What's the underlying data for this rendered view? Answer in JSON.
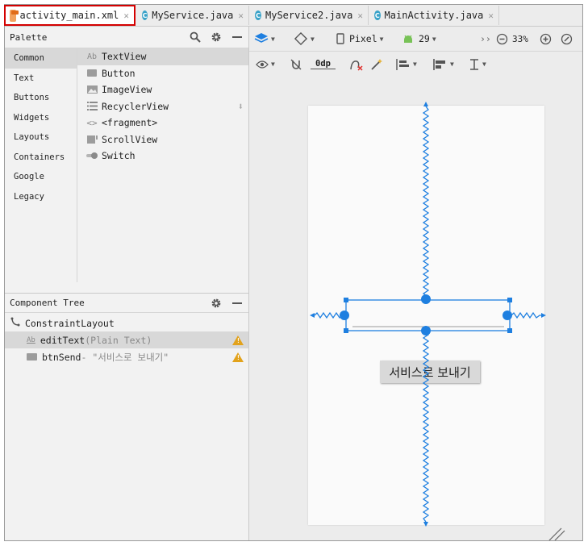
{
  "tabs": [
    {
      "label": "activity_main.xml",
      "icon": "xml-file-icon",
      "active": true
    },
    {
      "label": "MyService.java",
      "icon": "java-class-icon",
      "active": false
    },
    {
      "label": "MyService2.java",
      "icon": "java-class-icon",
      "active": false
    },
    {
      "label": "MainActivity.java",
      "icon": "java-class-icon",
      "active": false
    }
  ],
  "palette": {
    "title": "Palette",
    "categories": [
      "Common",
      "Text",
      "Buttons",
      "Widgets",
      "Layouts",
      "Containers",
      "Google",
      "Legacy"
    ],
    "selected_category": "Common",
    "items": [
      {
        "label": "TextView",
        "icon": "textview-icon"
      },
      {
        "label": "Button",
        "icon": "button-icon"
      },
      {
        "label": "ImageView",
        "icon": "imageview-icon"
      },
      {
        "label": "RecyclerView",
        "icon": "recyclerview-icon"
      },
      {
        "label": "<fragment>",
        "icon": "fragment-icon"
      },
      {
        "label": "ScrollView",
        "icon": "scrollview-icon"
      },
      {
        "label": "Switch",
        "icon": "switch-icon"
      }
    ]
  },
  "component_tree": {
    "title": "Component Tree",
    "root": "ConstraintLayout",
    "children": [
      {
        "icon_text": "Ab",
        "name": "editText",
        "hint": "(Plain Text)"
      },
      {
        "icon_text": "",
        "name": "btnSend",
        "hint": "- \"서비스로 보내기\""
      }
    ]
  },
  "toolbar": {
    "device": "Pixel",
    "api": "29",
    "zoom": "33%",
    "margin": "0dp",
    "overflow": "››"
  },
  "design": {
    "button_text": "서비스로 보내기"
  },
  "colors": {
    "accent": "#1e7fe0",
    "warning": "#e2a21b",
    "active_tab_outline": "#d40000"
  }
}
